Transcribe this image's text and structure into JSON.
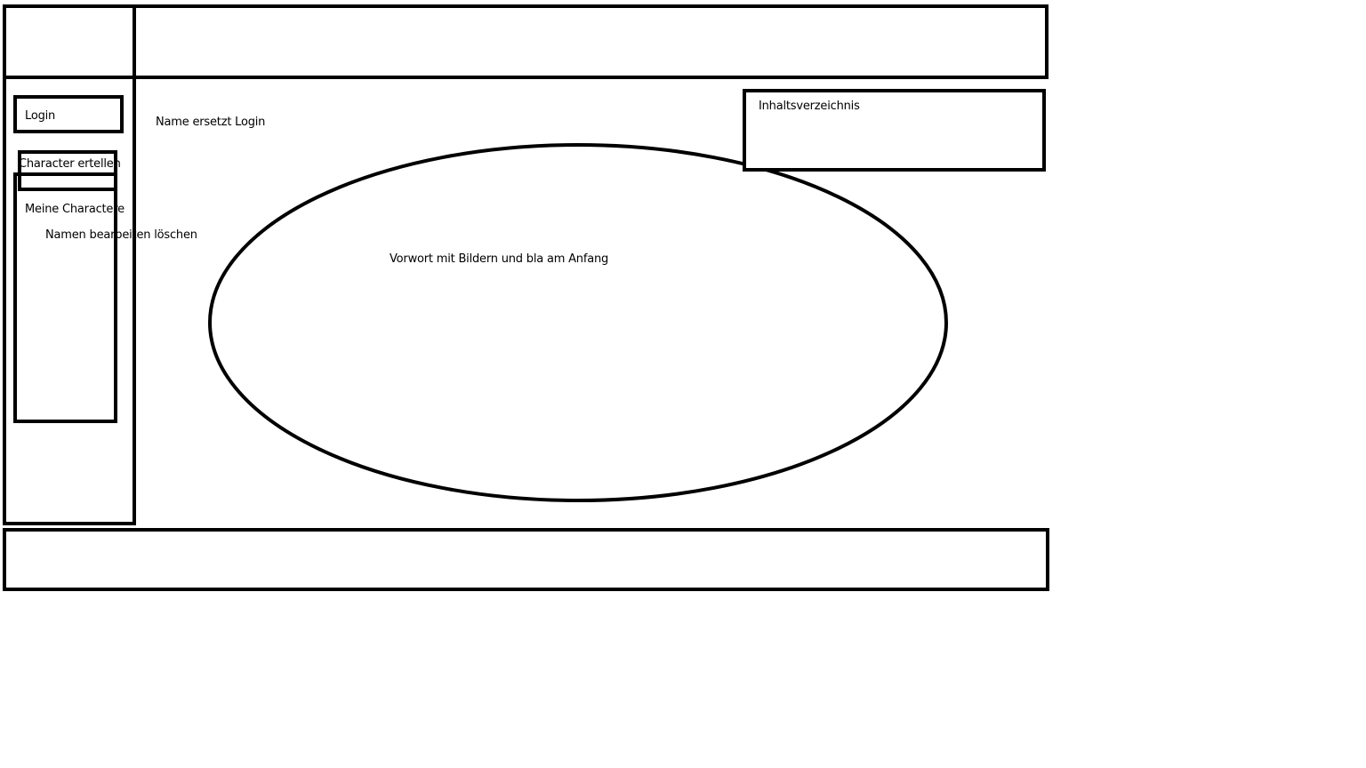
{
  "sidebar": {
    "login_label": "Login",
    "create_character_label": "Character ertellen",
    "my_characters_label": "Meine Charactere",
    "character_actions_label": "Namen bearbeiten löschen"
  },
  "main": {
    "login_note": "Name ersetzt Login",
    "intro_text": "Vorwort mit Bildern und bla am Anfang"
  },
  "toc": {
    "label": "Inhaltsverzeichnis"
  }
}
